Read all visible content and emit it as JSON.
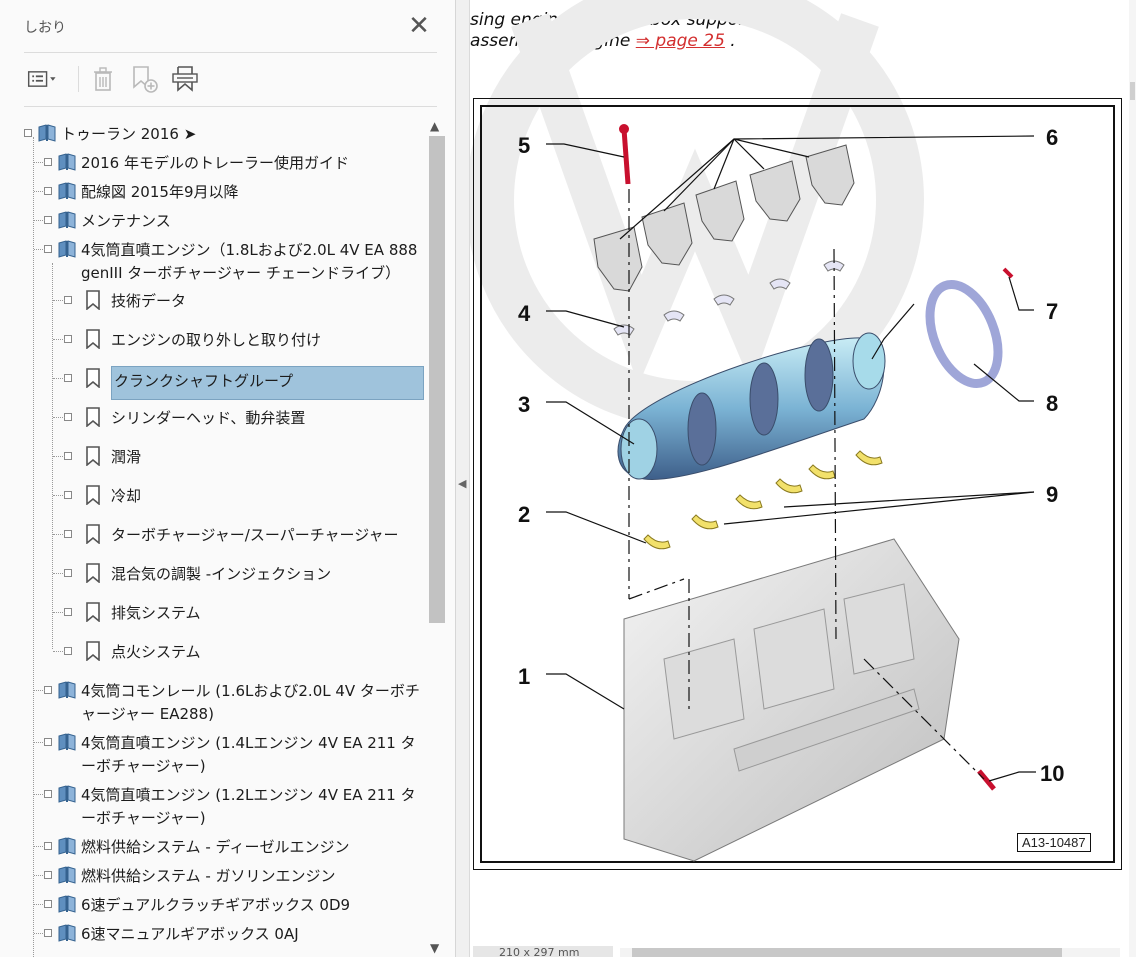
{
  "panel": {
    "title": "しおり",
    "close_icon": "close-icon",
    "toolbar": [
      "options-menu-icon",
      "delete-icon",
      "new-bookmark-icon",
      "find-bookmark-icon"
    ]
  },
  "tree": {
    "root": "トゥーラン 2016 ➤",
    "items": [
      {
        "label": "2016 年モデルのトレーラー使用ガイド",
        "level": 1,
        "icon": "book-icon"
      },
      {
        "label": "配線図  2015年9月以降",
        "level": 1,
        "icon": "book-icon"
      },
      {
        "label": "メンテナンス",
        "level": 1,
        "icon": "book-icon"
      },
      {
        "label": "4気筒直噴エンジン（1.8Lおよび2.0L 4V EA 888 genIII ターボチャージャー チェーンドライブ）",
        "level": 1,
        "icon": "book-icon"
      },
      {
        "label": "技術データ",
        "level": 2,
        "icon": "bookmark-icon"
      },
      {
        "label": "エンジンの取り外しと取り付け",
        "level": 2,
        "icon": "bookmark-icon"
      },
      {
        "label": "クランクシャフトグループ",
        "level": 2,
        "icon": "bookmark-icon",
        "selected": true
      },
      {
        "label": "シリンダーヘッド、動弁装置",
        "level": 2,
        "icon": "bookmark-icon"
      },
      {
        "label": "潤滑",
        "level": 2,
        "icon": "bookmark-icon"
      },
      {
        "label": "冷却",
        "level": 2,
        "icon": "bookmark-icon"
      },
      {
        "label": "ターボチャージャー/スーパーチャージャー",
        "level": 2,
        "icon": "bookmark-icon"
      },
      {
        "label": "混合気の調製 -インジェクション",
        "level": 2,
        "icon": "bookmark-icon"
      },
      {
        "label": "排気システム",
        "level": 2,
        "icon": "bookmark-icon"
      },
      {
        "label": "点火システム",
        "level": 2,
        "icon": "bookmark-icon"
      },
      {
        "label": "4気筒コモンレール (1.6Lおよび2.0L 4V ターボチャージャー EA288)",
        "level": 1,
        "icon": "book-icon"
      },
      {
        "label": "4気筒直噴エンジン (1.4Lエンジン 4V EA 211 ターボチャージャー)",
        "level": 1,
        "icon": "book-icon"
      },
      {
        "label": "4気筒直噴エンジン (1.2Lエンジン 4V EA 211 ターボチャージャー)",
        "level": 1,
        "icon": "book-icon"
      },
      {
        "label": "燃料供給システム - ディーゼルエンジン",
        "level": 1,
        "icon": "book-icon"
      },
      {
        "label": "燃料供給システム  -  ガソリンエンジン",
        "level": 1,
        "icon": "book-icon"
      },
      {
        "label": "6速デュアルクラッチギアボックス  0D9",
        "level": 1,
        "icon": "book-icon"
      },
      {
        "label": "6速マニュアルギアボックス  0AJ",
        "level": 1,
        "icon": "book-icon"
      }
    ]
  },
  "document": {
    "line1": "sing engine and gearbox support",
    "line2_prefix": "assembling engine ",
    "line2_link": "⇒ page 25",
    "line2_suffix": " .",
    "figure_id": "A13-10487",
    "callouts": [
      "5",
      "6",
      "4",
      "7",
      "8",
      "3",
      "9",
      "2",
      "1",
      "10"
    ],
    "page_size": "210 x 297 mm"
  }
}
